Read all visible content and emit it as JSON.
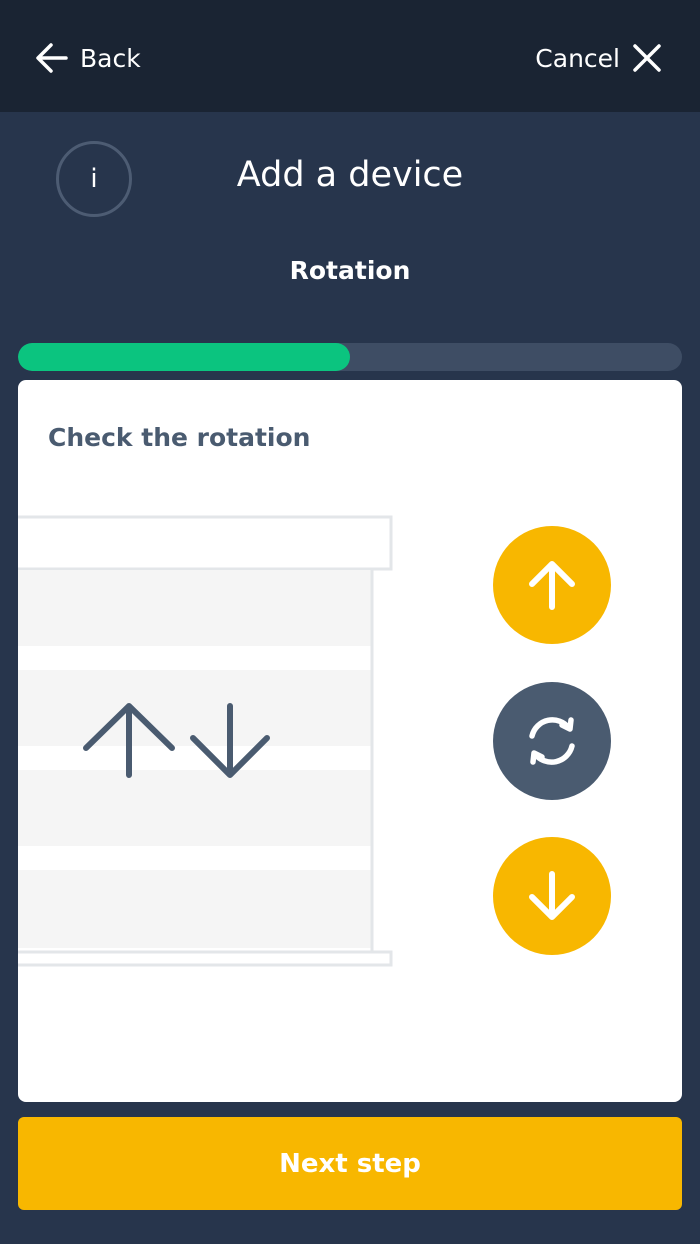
{
  "header": {
    "back_label": "Back",
    "cancel_label": "Cancel"
  },
  "page": {
    "title": "Add a device",
    "subtitle": "Rotation",
    "info_icon_glyph": "i"
  },
  "progress": {
    "fraction": 0.5
  },
  "card": {
    "title": "Check the rotation"
  },
  "controls": {
    "up_icon": "arrow-up-icon",
    "rotate_icon": "rotate-icon",
    "down_icon": "arrow-down-icon"
  },
  "footer": {
    "next_label": "Next step"
  },
  "colors": {
    "header_bg": "#1a2433",
    "page_bg": "#27354c",
    "accent_yellow": "#f8b700",
    "progress_green": "#0bc47f",
    "slate": "#4a5b70"
  }
}
